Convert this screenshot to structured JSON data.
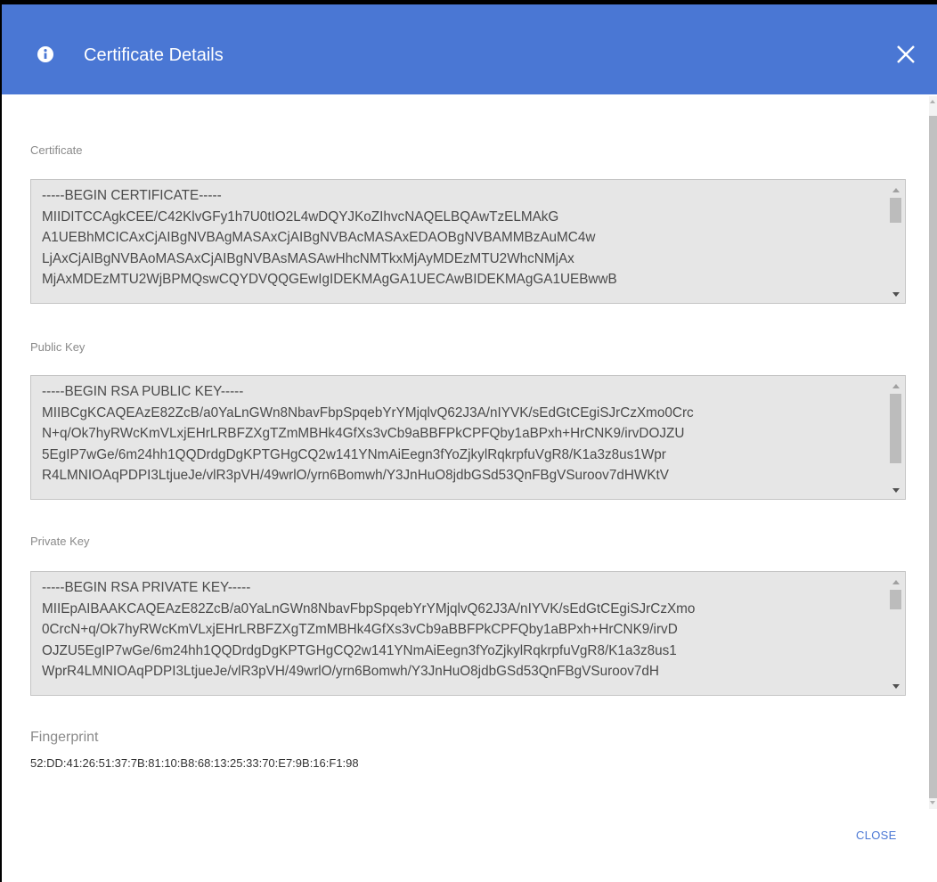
{
  "dialog": {
    "title": "Certificate Details",
    "accent_color": "#4a77d4",
    "icons": {
      "header": "info-icon",
      "close": "close-icon"
    }
  },
  "certificate": {
    "label": "Certificate",
    "lines": [
      "-----BEGIN CERTIFICATE-----",
      "MIIDITCCAgkCEE/C42KlvGFy1h7U0tIO2L4wDQYJKoZIhvcNAQELBQAwTzELMAkG",
      "A1UEBhMCICAxCjAIBgNVBAgMASAxCjAIBgNVBAcMASAxEDAOBgNVBAMMBzAuMC4w",
      "LjAxCjAIBgNVBAoMASAxCjAIBgNVBAsMASAwHhcNMTkxMjAyMDEzMTU2WhcNMjAx",
      "MjAxMDEzMTU2WjBPMQswCQYDVQQGEwIgIDEKMAgGA1UECAwBIDEKMAgGA1UEBwwB"
    ]
  },
  "public_key": {
    "label": "Public Key",
    "lines": [
      "-----BEGIN RSA PUBLIC KEY-----",
      "MIIBCgKCAQEAzE82ZcB/a0YaLnGWn8NbavFbpSpqebYrYMjqlvQ62J3A/nIYVK/sEdGtCEgiSJrCzXmo0Crc",
      "N+q/Ok7hyRWcKmVLxjEHrLRBFZXgTZmMBHk4GfXs3vCb9aBBFPkCPFQby1aBPxh+HrCNK9/irvDOJZU",
      "5EgIP7wGe/6m24hh1QQDrdgDgKPTGHgCQ2w141YNmAiEegn3fYoZjkylRqkrpfuVgR8/K1a3z8us1Wpr",
      "R4LMNIOAqPDPI3LtjueJe/vlR3pVH/49wrlO/yrn6Bomwh/Y3JnHuO8jdbGSd53QnFBgVSuroov7dHWKtV"
    ]
  },
  "private_key": {
    "label": "Private Key",
    "lines": [
      "-----BEGIN RSA PRIVATE KEY-----",
      "MIIEpAIBAAKCAQEAzE82ZcB/a0YaLnGWn8NbavFbpSpqebYrYMjqlvQ62J3A/nIYVK/sEdGtCEgiSJrCzXmo",
      "0CrcN+q/Ok7hyRWcKmVLxjEHrLRBFZXgTZmMBHk4GfXs3vCb9aBBFPkCPFQby1aBPxh+HrCNK9/irvD",
      "OJZU5EgIP7wGe/6m24hh1QQDrdgDgKPTGHgCQ2w141YNmAiEegn3fYoZjkylRqkrpfuVgR8/K1a3z8us1",
      "WprR4LMNIOAqPDPI3LtjueJe/vlR3pVH/49wrlO/yrn6Bomwh/Y3JnHuO8jdbGSd53QnFBgVSuroov7dH"
    ]
  },
  "fingerprint": {
    "label": "Fingerprint",
    "value": "52:DD:41:26:51:37:7B:81:10:B8:68:13:25:33:70:E7:9B:16:F1:98"
  },
  "footer": {
    "close_label": "CLOSE"
  }
}
